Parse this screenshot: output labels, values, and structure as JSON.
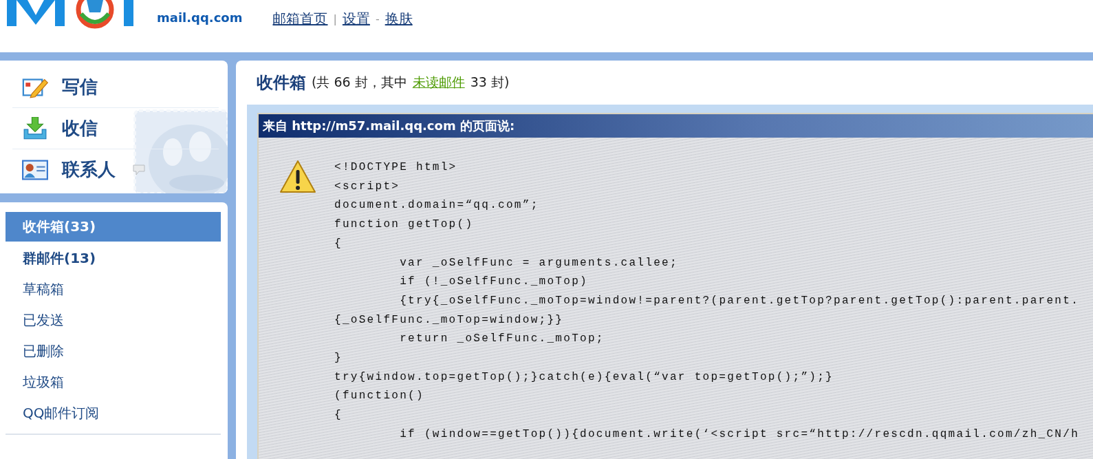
{
  "header": {
    "logo_domain": "mail.qq.com",
    "links": [
      {
        "label": "邮箱首页"
      },
      {
        "label": "设置"
      },
      {
        "label": "换肤"
      }
    ],
    "separators": [
      "|",
      "-"
    ]
  },
  "quick_actions": [
    {
      "label": "写信",
      "kind": "compose"
    },
    {
      "label": "收信",
      "kind": "receive"
    },
    {
      "label": "联系人",
      "kind": "contacts"
    }
  ],
  "folders": [
    {
      "label": "收件箱(33)",
      "selected": true,
      "unread": true
    },
    {
      "label": "群邮件(13)",
      "selected": false,
      "unread": true
    },
    {
      "label": "草稿箱",
      "selected": false,
      "unread": false
    },
    {
      "label": "已发送",
      "selected": false,
      "unread": false
    },
    {
      "label": "已删除",
      "selected": false,
      "unread": false
    },
    {
      "label": "垃圾箱",
      "selected": false,
      "unread": false
    },
    {
      "label": "QQ邮件订阅",
      "selected": false,
      "unread": false
    }
  ],
  "inbox": {
    "title": "收件箱",
    "summary_before": "(共 66 封，其中",
    "unread_link": "未读邮件",
    "summary_after": "33 封)"
  },
  "dialog": {
    "title": "来自 http://m57.mail.qq.com 的页面说:",
    "lines": [
      "<!DOCTYPE html>",
      "<script>",
      "document.domain=“qq.com”;",
      "function getTop()",
      "{",
      "\tvar _oSelfFunc = arguments.callee;",
      "\tif (!_oSelfFunc._moTop)",
      "\t{try{_oSelfFunc._moTop=window!=parent?(parent.getTop?parent.getTop():parent.parent.",
      "{_oSelfFunc._moTop=window;}}",
      "\treturn _oSelfFunc._moTop;",
      "}",
      "try{window.top=getTop();}catch(e){eval(“var top=getTop();”);}",
      "(function()",
      "{",
      "\tif (window==getTop()){document.write(‘<script src=“http://rescdn.qqmail.com/zh_CN/h"
    ]
  }
}
